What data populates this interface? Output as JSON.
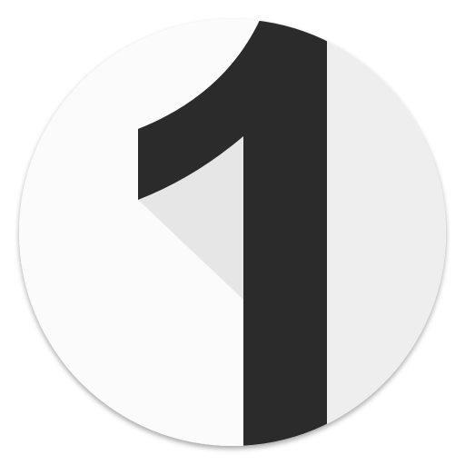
{
  "icon": {
    "name": "numeral-one-app-icon",
    "glyph": "1"
  },
  "colors": {
    "page_background": "#ffffff",
    "circle_face": "#fbfbfb",
    "circle_right_shade": "#eeeeee",
    "long_shadow": "#e6e6e6",
    "numeral": "#2b2b2b"
  }
}
